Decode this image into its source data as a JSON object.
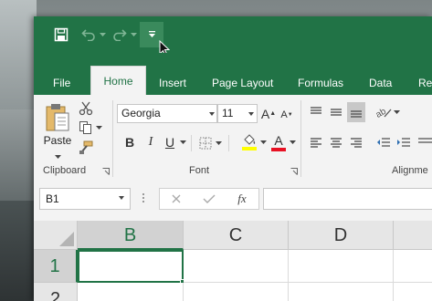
{
  "window": {
    "quick_access": {
      "save_icon": "save-icon",
      "undo_icon": "undo-icon",
      "redo_icon": "redo-icon",
      "customize_icon": "customize-qat-icon"
    },
    "tabs": [
      {
        "label": "File"
      },
      {
        "label": "Home"
      },
      {
        "label": "Insert"
      },
      {
        "label": "Page Layout"
      },
      {
        "label": "Formulas"
      },
      {
        "label": "Data"
      },
      {
        "label": "Re"
      }
    ],
    "active_tab": "Home",
    "accent_color": "#217346"
  },
  "ribbon": {
    "clipboard": {
      "group_label": "Clipboard",
      "paste_label": "Paste"
    },
    "font": {
      "group_label": "Font",
      "font_name": "Georgia",
      "font_size": "11",
      "bold": "B",
      "italic": "I",
      "underline": "U",
      "grow": "A",
      "shrink": "A",
      "font_color_letter": "A",
      "highlight_color": "#ffff00",
      "font_color": "#e81123"
    },
    "alignment": {
      "group_label": "Alignme"
    }
  },
  "formula_bar": {
    "name_box": "B1",
    "cancel_icon": "cancel-icon",
    "enter_icon": "enter-icon",
    "function_label": "fx",
    "formula_value": ""
  },
  "sheet": {
    "columns": [
      "B",
      "C",
      "D"
    ],
    "rows": [
      "1",
      "2"
    ],
    "selected_cell": "B1"
  }
}
